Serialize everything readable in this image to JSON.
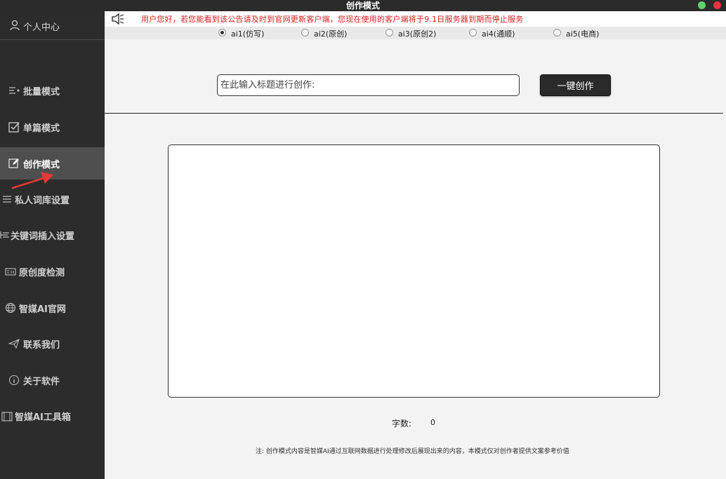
{
  "window": {
    "title": "创作模式"
  },
  "sidebar": {
    "user_center": "个人中心",
    "items": [
      {
        "label": "批量模式",
        "icon": "batch-list-icon"
      },
      {
        "label": "单篇模式",
        "icon": "checkbox-icon"
      },
      {
        "label": "创作模式",
        "icon": "edit-icon",
        "active": true
      },
      {
        "label": "私人词库设置",
        "icon": "list-icon"
      },
      {
        "label": "关键词插入设置",
        "icon": "insert-icon"
      },
      {
        "label": "原创度检测",
        "icon": "detect-icon"
      },
      {
        "label": "智媒AI官网",
        "icon": "globe-icon"
      },
      {
        "label": "联系我们",
        "icon": "send-icon"
      },
      {
        "label": "关于软件",
        "icon": "info-icon"
      },
      {
        "label": "智媒AI工具箱",
        "icon": "toolbox-icon"
      }
    ]
  },
  "notice": {
    "text": "用户您好，若您能看到该公告请及时到官网更新客户端，您现在使用的客户端将于9.1日服务器到期而停止服务"
  },
  "ai_options": [
    {
      "label": "ai1(仿写)",
      "selected": true
    },
    {
      "label": "ai2(原创)",
      "selected": false
    },
    {
      "label": "ai3(原创2)",
      "selected": false
    },
    {
      "label": "ai4(通顺)",
      "selected": false
    },
    {
      "label": "ai5(电商)",
      "selected": false
    }
  ],
  "input": {
    "placeholder": "在此输入标题进行创作:",
    "value": ""
  },
  "create_button": "一键创作",
  "word_count": {
    "label": "字数:",
    "value": "0"
  },
  "footnote": "注: 创作模式内容是智媒AI通过互联网数据进行处理修改后展现出来的内容，本模式仅对创作者提供文案参考价值",
  "colors": {
    "sidebar_bg": "#2c2c2c",
    "sidebar_active": "#4f4f4f",
    "notice_red": "#d21f1f",
    "annotation_arrow": "#e53935"
  }
}
